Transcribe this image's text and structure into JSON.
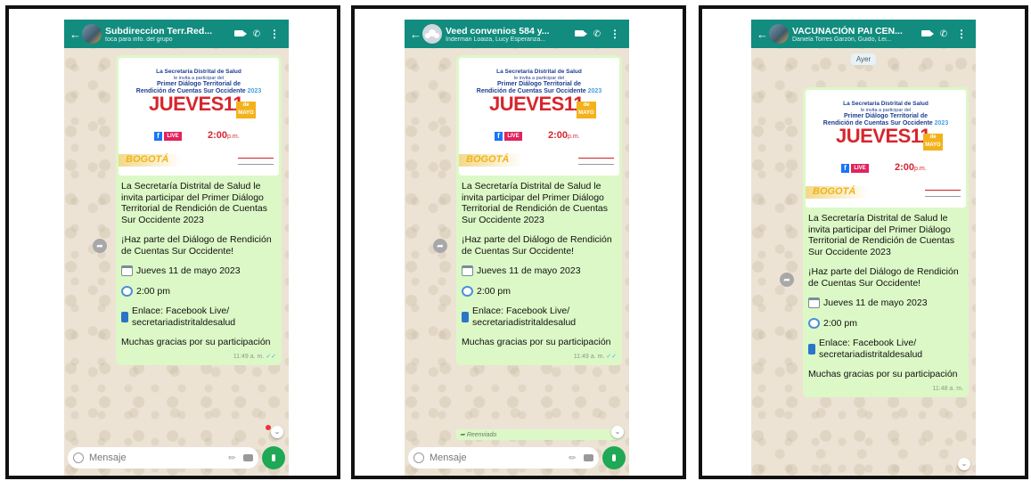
{
  "shared": {
    "poster": {
      "line1": "La Secretaría Distrital de Salud",
      "line2": "le invita a participar del",
      "line3": "Primer Diálogo Territorial de",
      "line4": "Rendición de Cuentas Sur Occidente",
      "year": "2023",
      "day": "JUEVES11",
      "month": "de MAYO",
      "fb": "f",
      "live": "LIVE",
      "time": "2:00",
      "time_suffix": "p.m.",
      "logo": "BOGOTÁ"
    },
    "message": {
      "para1": "La Secretaría Distrital de Salud le invita participar del Primer Diálogo Territorial de Rendición de Cuentas Sur Occidente 2023",
      "para2": "¡Haz parte del Diálogo de Rendición de Cuentas Sur Occidente!",
      "date_line": "Jueves 11 de mayo 2023",
      "time_line": "2:00 pm",
      "link_line": "Enlace: Facebook Live/ secretariadistritaldesalud",
      "thanks": "Muchas gracias por su participación"
    },
    "composer_placeholder": "Mensaje",
    "icons": [
      "back-arrow-icon",
      "video-call-icon",
      "phone-icon",
      "more-icon",
      "forward-icon",
      "emoji-icon",
      "attach-icon",
      "camera-icon",
      "mic-icon",
      "calendar-icon",
      "alarm-clock-icon",
      "mobile-phone-icon",
      "chevron-down-icon"
    ],
    "colors": {
      "header": "#128c7e",
      "bubble": "#dcf8c6",
      "chat_bg": "#ece3d5",
      "mic": "#1fa855"
    }
  },
  "screens": [
    {
      "chat_title": "Subdireccion Terr.Red...",
      "chat_subtitle": "toca para info. del grupo",
      "timestamp": "11:49 a. m."
    },
    {
      "chat_title": "Veed convenios 584 y...",
      "chat_subtitle": "Inderman Loaiza, Lucy Esperanza...",
      "timestamp": "11:49 a. m.",
      "forwarded_label": "Reenviado"
    },
    {
      "chat_title": "VACUNACIÓN PAI CEN...",
      "chat_subtitle": "Daniela Torres Garzón, Guido, Lei...",
      "date_chip": "Ayer",
      "timestamp": "11:48 a. m."
    }
  ]
}
